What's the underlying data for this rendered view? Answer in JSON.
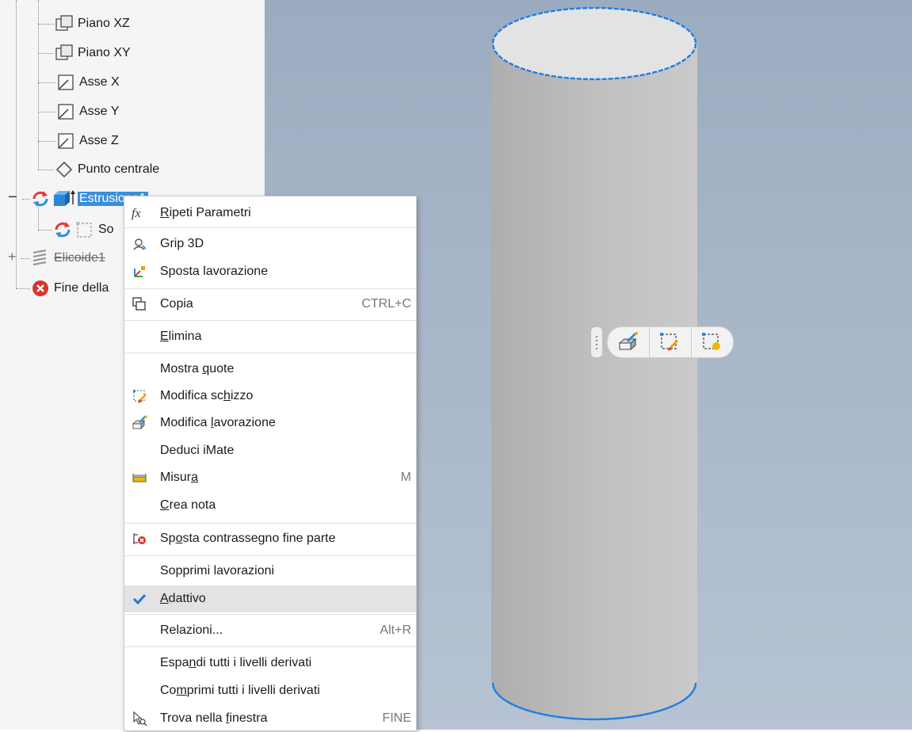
{
  "tree": {
    "items": [
      {
        "label": "Piano XZ"
      },
      {
        "label": "Piano XY"
      },
      {
        "label": "Asse X"
      },
      {
        "label": "Asse Y"
      },
      {
        "label": "Asse Z"
      },
      {
        "label": "Punto centrale"
      },
      {
        "label": "Estrusione1"
      },
      {
        "label": "So"
      },
      {
        "label": "Elicoide1"
      },
      {
        "label": "Fine della"
      }
    ],
    "expand_collapse": "−",
    "expand_plus": "+"
  },
  "context_menu": {
    "items": [
      {
        "icon": "fx-icon",
        "pre": "",
        "u": "R",
        "post": "ipeti Parametri",
        "shortcut": ""
      },
      {
        "icon": "grip-3d-icon",
        "pre": "Grip 3D",
        "u": "",
        "post": "",
        "shortcut": ""
      },
      {
        "icon": "move-feature-icon",
        "pre": "Sposta lavorazione",
        "u": "",
        "post": "",
        "shortcut": ""
      },
      {
        "icon": "copy-icon",
        "pre": "Copia",
        "u": "",
        "post": "",
        "shortcut": "CTRL+C"
      },
      {
        "icon": "",
        "pre": "",
        "u": "E",
        "post": "limina",
        "shortcut": ""
      },
      {
        "icon": "",
        "pre": "Mostra ",
        "u": "q",
        "post": "uote",
        "shortcut": ""
      },
      {
        "icon": "edit-sketch-icon",
        "pre": "Modifica sc",
        "u": "h",
        "post": "izzo",
        "shortcut": ""
      },
      {
        "icon": "edit-feature-icon",
        "pre": "Modifica ",
        "u": "l",
        "post": "avorazione",
        "shortcut": ""
      },
      {
        "icon": "",
        "pre": "Deduci iMate",
        "u": "",
        "post": "",
        "shortcut": ""
      },
      {
        "icon": "measure-icon",
        "pre": "Misur",
        "u": "a",
        "post": "",
        "shortcut": "M"
      },
      {
        "icon": "",
        "pre": "",
        "u": "C",
        "post": "rea nota",
        "shortcut": ""
      },
      {
        "icon": "move-eop-icon",
        "pre": "Sp",
        "u": "o",
        "post": "sta contrassegno fine parte",
        "shortcut": ""
      },
      {
        "icon": "",
        "pre": "Sopprimi lavorazioni",
        "u": "",
        "post": "",
        "shortcut": ""
      },
      {
        "icon": "checkmark-icon",
        "pre": "",
        "u": "A",
        "post": "dattivo",
        "shortcut": ""
      },
      {
        "icon": "",
        "pre": "Relazioni...",
        "u": "",
        "post": "",
        "shortcut": "Alt+R"
      },
      {
        "icon": "",
        "pre": "Espa",
        "u": "n",
        "post": "di tutti i livelli derivati",
        "shortcut": ""
      },
      {
        "icon": "",
        "pre": "Co",
        "u": "m",
        "post": "primi tutti i livelli derivati",
        "shortcut": ""
      },
      {
        "icon": "find-in-window-icon",
        "pre": "Trova nella ",
        "u": "f",
        "post": "inestra",
        "shortcut": "FINE"
      }
    ]
  },
  "colors": {
    "selection": "#3b8fd8",
    "edge_highlight": "#1e7fe0",
    "check": "#1f7ad6",
    "error": "#d9332b"
  }
}
